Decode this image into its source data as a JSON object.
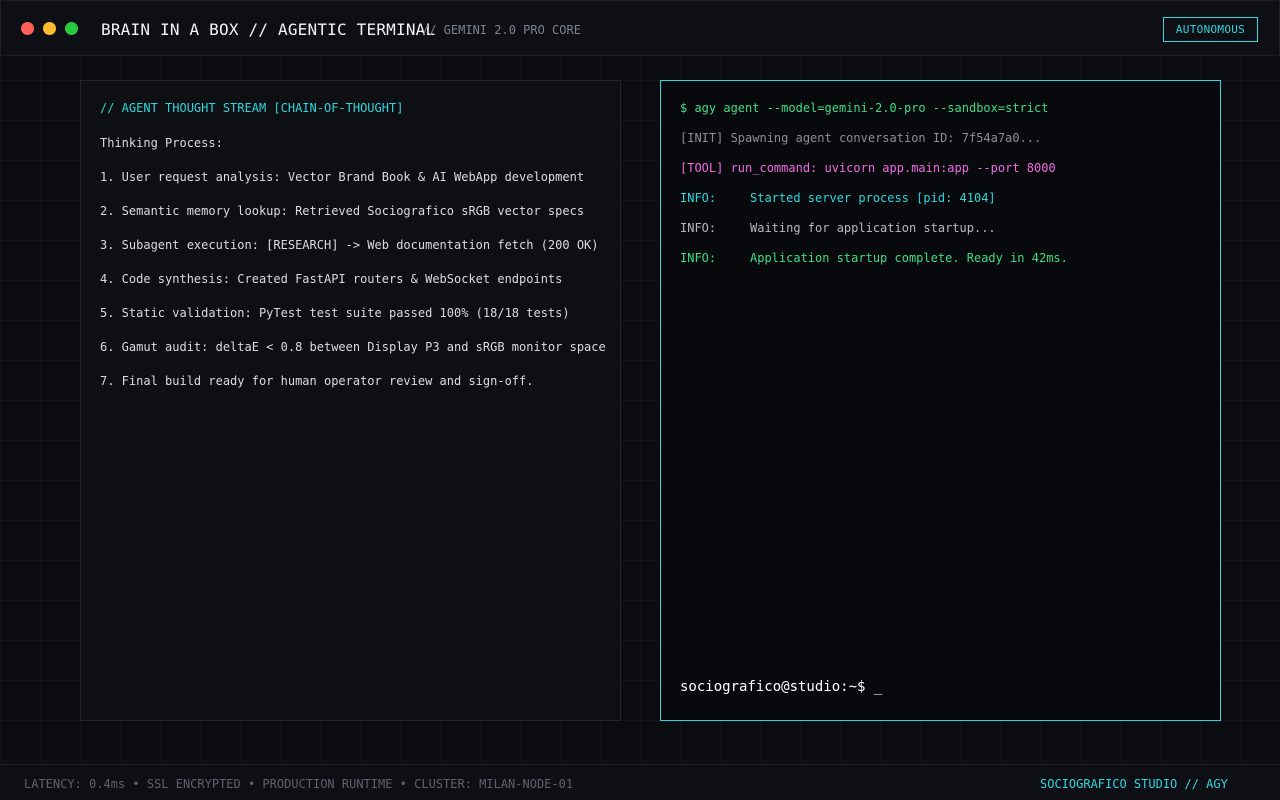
{
  "window": {
    "title": "BRAIN IN A BOX // AGENTIC TERMINAL",
    "subtitle": "// GEMINI 2.0 PRO CORE",
    "mode_badge": "AUTONOMOUS",
    "controls": [
      "close",
      "minimize",
      "maximize"
    ]
  },
  "thought_panel": {
    "heading": "// AGENT THOUGHT STREAM [CHAIN-OF-THOUGHT]",
    "label": "Thinking Process:",
    "steps": [
      "1. User request analysis: Vector Brand Book & AI WebApp development",
      "2. Semantic memory lookup: Retrieved Sociografico sRGB vector specs",
      "3. Subagent execution: [RESEARCH] -> Web documentation fetch (200 OK)",
      "4. Code synthesis: Created FastAPI routers & WebSocket endpoints",
      "5. Static validation: PyTest test suite passed 100% (18/18 tests)",
      "6. Gamut audit: deltaE < 0.8 between Display P3 and sRGB monitor space",
      "7. Final build ready for human operator review and sign-off."
    ]
  },
  "terminal": {
    "command": "$ agy agent --model=gemini-2.0-pro --sandbox=strict",
    "init_line": "[INIT] Spawning agent conversation ID: 7f54a7a0...",
    "tool_line": "[TOOL] run_command: uvicorn app.main:app --port 8000",
    "logs": [
      {
        "level": "INFO:",
        "message": "Started server process [pid: 4104]"
      },
      {
        "level": "INFO:",
        "message": "Waiting for application startup..."
      },
      {
        "level": "INFO:",
        "message": "Application startup complete. Ready in 42ms."
      }
    ],
    "prompt": "sociografico@studio:~$",
    "cursor": "_"
  },
  "statusbar": {
    "left": "LATENCY: 0.4ms • SSL ENCRYPTED • PRODUCTION RUNTIME • CLUSTER: MILAN-NODE-01",
    "right": "SOCIOGRAFICO STUDIO // AGY"
  },
  "colors": {
    "accent_cyan": "#2fd6dc",
    "command_green": "#3ddc84",
    "tool_magenta": "#f06be0",
    "muted_gray": "#8a8e99",
    "background": "#0b0c10"
  }
}
